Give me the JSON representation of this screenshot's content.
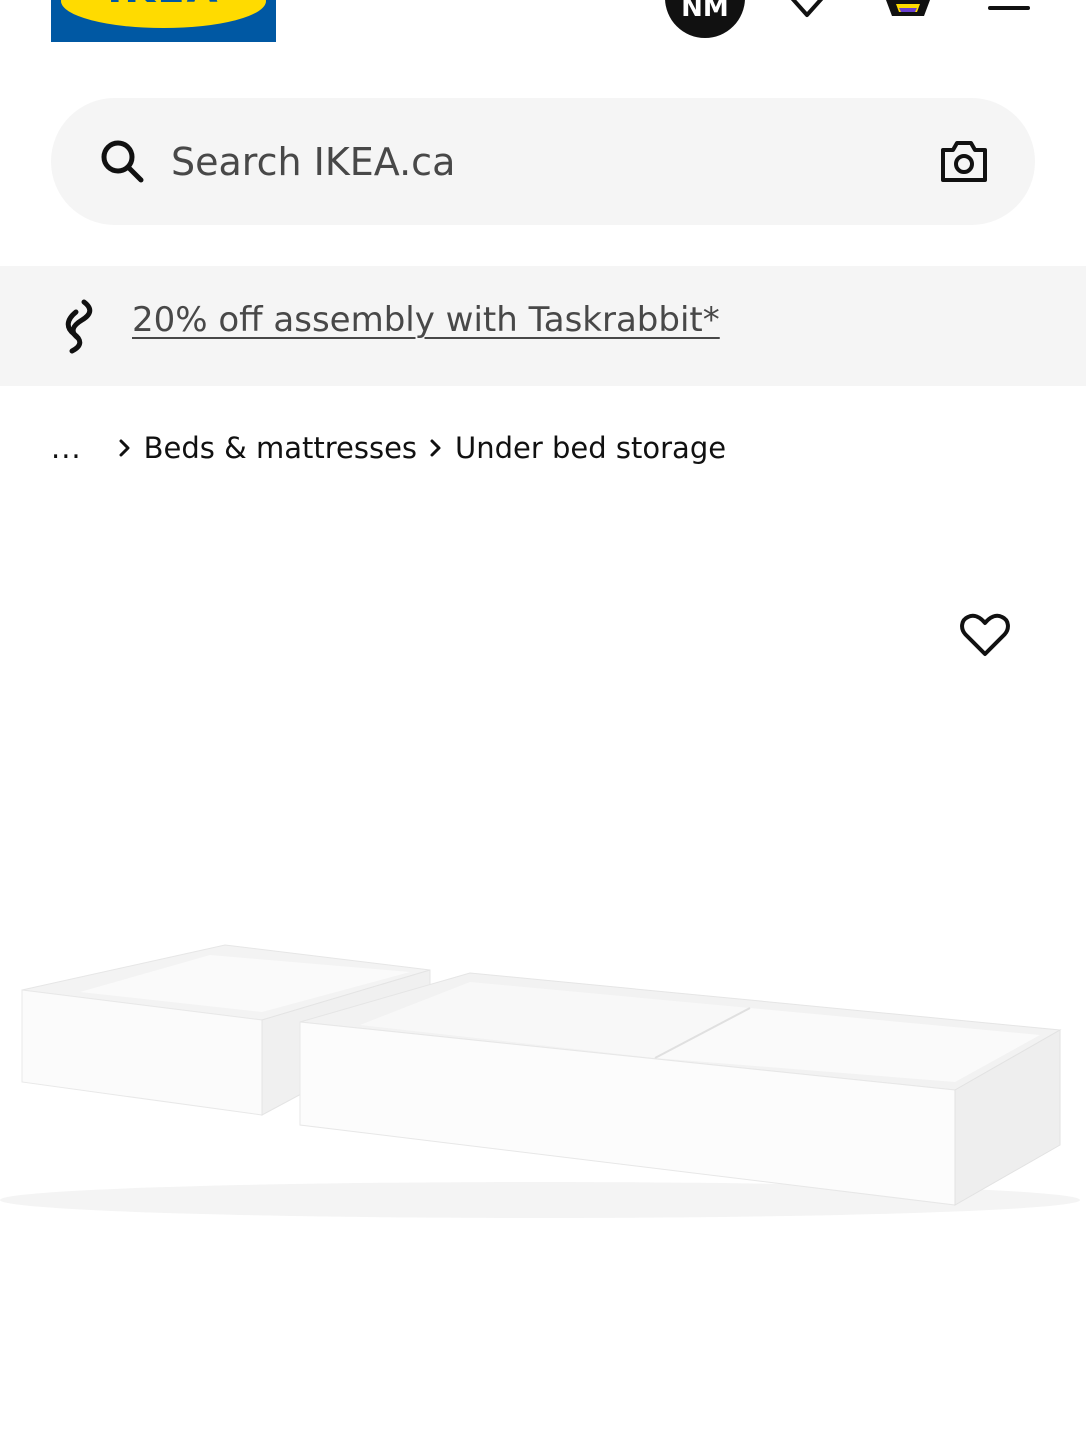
{
  "header": {
    "logo_text": "IKEA",
    "avatar_initials": "NM",
    "brand_blue": "#0058a3",
    "brand_yellow": "#ffdb00",
    "icons": [
      "heart-icon",
      "shopping-bag-icon",
      "hamburger-menu-icon"
    ]
  },
  "search": {
    "placeholder": "Search IKEA.ca",
    "icons": [
      "search-icon",
      "camera-icon"
    ]
  },
  "promo": {
    "link_text": "20% off assembly with Taskrabbit*",
    "icon": "taskrabbit-icon"
  },
  "breadcrumb": {
    "ellipsis": "...",
    "items": [
      "Beds & mattresses",
      "Under bed storage"
    ]
  },
  "product": {
    "favourite_icon": "heart-outline-icon",
    "image": "white-under-bed-storage-boxes"
  }
}
